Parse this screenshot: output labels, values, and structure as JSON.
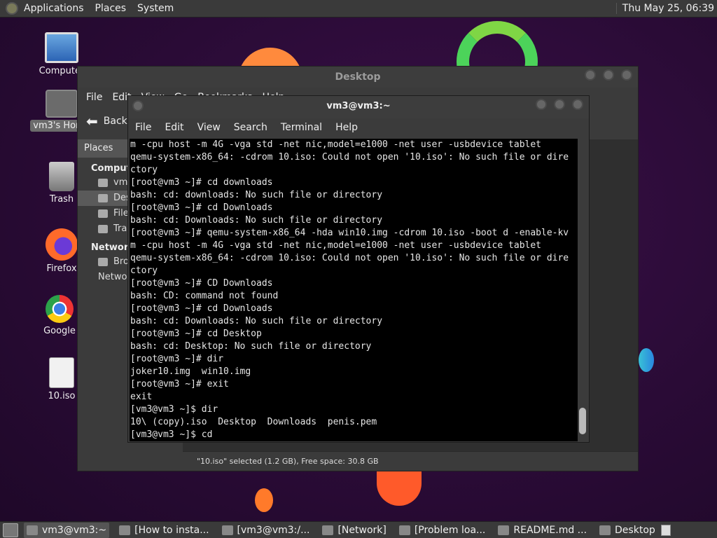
{
  "top_panel": {
    "menus": [
      "Applications",
      "Places",
      "System"
    ],
    "clock": "Thu May 25, 06:39"
  },
  "desktop_icons": [
    {
      "label": "Computer",
      "icon": "computer-icon"
    },
    {
      "label": "vm3's Home",
      "icon": "home-folder-icon"
    },
    {
      "label": "Trash",
      "icon": "trash-icon"
    },
    {
      "label": "Firefox",
      "icon": "firefox-icon"
    },
    {
      "label": "Google",
      "icon": "chrome-icon"
    },
    {
      "label": "10.iso",
      "icon": "disc-image-icon"
    }
  ],
  "file_manager": {
    "title": "Desktop",
    "menus": [
      "File",
      "Edit",
      "View",
      "Go",
      "Bookmarks",
      "Help"
    ],
    "back_label": "Back",
    "sidebar": {
      "places_label": "Places",
      "computer_section": "Computer",
      "items": [
        "vm3",
        "Desktop",
        "File System",
        "Trash"
      ],
      "network_section": "Network",
      "network_items": [
        "Browse Network"
      ]
    },
    "status": "\"10.iso\" selected (1.2 GB), Free space: 30.8 GB"
  },
  "terminal": {
    "title": "vm3@vm3:~",
    "menus": [
      "File",
      "Edit",
      "View",
      "Search",
      "Terminal",
      "Help"
    ],
    "lines": [
      "m -cpu host -m 4G -vga std -net nic,model=e1000 -net user -usbdevice tablet",
      "qemu-system-x86_64: -cdrom 10.iso: Could not open '10.iso': No such file or dire",
      "ctory",
      "[root@vm3 ~]# cd downloads",
      "bash: cd: downloads: No such file or directory",
      "[root@vm3 ~]# cd Downloads",
      "bash: cd: Downloads: No such file or directory",
      "[root@vm3 ~]# qemu-system-x86_64 -hda win10.img -cdrom 10.iso -boot d -enable-kv",
      "m -cpu host -m 4G -vga std -net nic,model=e1000 -net user -usbdevice tablet",
      "qemu-system-x86_64: -cdrom 10.iso: Could not open '10.iso': No such file or dire",
      "ctory",
      "[root@vm3 ~]# CD Downloads",
      "bash: CD: command not found",
      "[root@vm3 ~]# cd Downloads",
      "bash: cd: Downloads: No such file or directory",
      "[root@vm3 ~]# cd Desktop",
      "bash: cd: Desktop: No such file or directory",
      "[root@vm3 ~]# dir",
      "joker10.img  win10.img",
      "[root@vm3 ~]# exit",
      "exit",
      "[vm3@vm3 ~]$ dir",
      "10\\ (copy).iso  Desktop  Downloads  penis.pem",
      "[vm3@vm3 ~]$ cd"
    ]
  },
  "taskbar": {
    "tasks": [
      {
        "label": "vm3@vm3:~",
        "icon": "terminal-icon",
        "active": true
      },
      {
        "label": "[How to insta...",
        "icon": "chrome-icon",
        "active": false
      },
      {
        "label": "[vm3@vm3:/...",
        "icon": "terminal-icon",
        "active": false
      },
      {
        "label": "[Network]",
        "icon": "network-folder-icon",
        "active": false
      },
      {
        "label": "[Problem loa...",
        "icon": "firefox-icon",
        "active": false
      },
      {
        "label": "README.md ...",
        "icon": "text-editor-icon",
        "active": false
      },
      {
        "label": "Desktop",
        "icon": "folder-icon",
        "active": false
      }
    ]
  }
}
